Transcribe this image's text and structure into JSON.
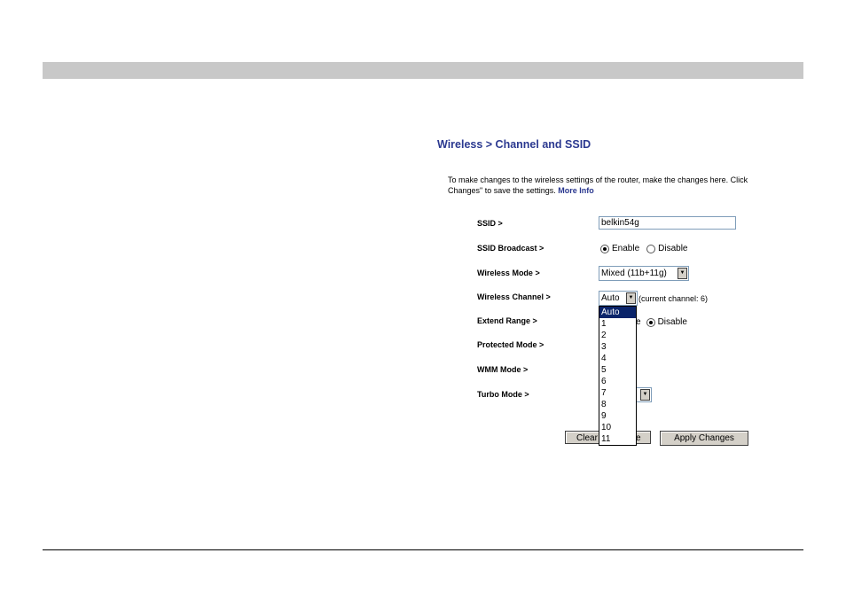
{
  "page": {
    "title": "Wireless > Channel and SSID",
    "intro_line1": "To make changes to the wireless settings of the router, make the changes here. Click",
    "intro_line2": "Changes\" to save the settings.",
    "more_info": "More Info"
  },
  "form": {
    "ssid": {
      "label": "SSID >",
      "value": "belkin54g"
    },
    "ssid_broadcast": {
      "label": "SSID Broadcast >",
      "enable": "Enable",
      "disable": "Disable",
      "selected": "Enable"
    },
    "wireless_mode": {
      "label": "Wireless Mode >",
      "value": "Mixed (11b+11g)"
    },
    "wireless_channel": {
      "label": "Wireless Channel >",
      "value": "Auto",
      "current": "(current channel: 6)",
      "options": [
        "Auto",
        "1",
        "2",
        "3",
        "4",
        "5",
        "6",
        "7",
        "8",
        "9",
        "10",
        "11"
      ]
    },
    "extend_range": {
      "label": "Extend Range >",
      "enable_fragment": "e",
      "disable": "Disable",
      "selected": "Disable"
    },
    "protected_mode": {
      "label": "Protected Mode >"
    },
    "wmm_mode": {
      "label": "WMM Mode >"
    },
    "turbo_mode": {
      "label": "Turbo Mode >"
    }
  },
  "buttons": {
    "clear_left": "Clear",
    "clear_right": "e",
    "apply": "Apply Changes"
  },
  "colors": {
    "accent": "#2b3990",
    "header_bar": "#c8c8c8",
    "selection": "#0a246a"
  }
}
